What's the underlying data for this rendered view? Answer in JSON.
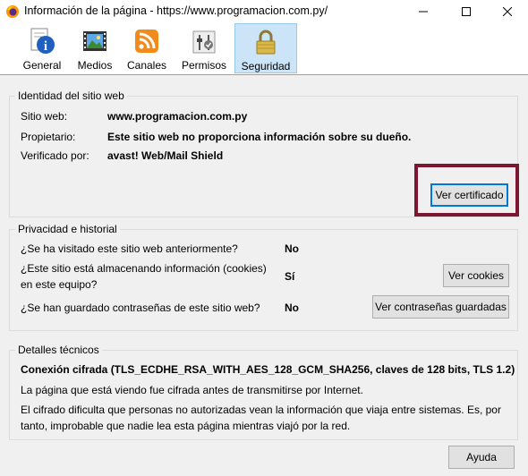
{
  "window": {
    "title": "Información de la página - https://www.programacion.com.py/"
  },
  "tabs": [
    {
      "label": "General",
      "icon": "info-icon"
    },
    {
      "label": "Medios",
      "icon": "media-icon"
    },
    {
      "label": "Canales",
      "icon": "rss-icon"
    },
    {
      "label": "Permisos",
      "icon": "permissions-icon"
    },
    {
      "label": "Seguridad",
      "icon": "lock-icon",
      "selected": true
    }
  ],
  "identity": {
    "legend": "Identidad del sitio web",
    "rows": [
      {
        "label": "Sitio web:",
        "value": "www.programacion.com.py"
      },
      {
        "label": "Propietario:",
        "value": "Este sitio web no proporciona información sobre su dueño."
      },
      {
        "label": "Verificado por:",
        "value": "avast! Web/Mail Shield"
      }
    ],
    "cert_button": "Ver certificado"
  },
  "privacy": {
    "legend": "Privacidad e historial",
    "q1": "¿Se ha visitado este sitio web anteriormente?",
    "a1": "No",
    "q2_line1": "¿Este sitio está almacenando información (cookies)",
    "q2_line2": "en este equipo?",
    "a2": "Sí",
    "cookies_button": "Ver cookies",
    "q3": "¿Se han guardado contraseñas de este sitio web?",
    "a3": "No",
    "passwords_button": "Ver contraseñas guardadas"
  },
  "technical": {
    "legend": "Detalles técnicos",
    "connection": "Conexión cifrada (TLS_ECDHE_RSA_WITH_AES_128_GCM_SHA256, claves de 128 bits, TLS 1.2)",
    "line1": "La página que está viendo fue cifrada antes de transmitirse por Internet.",
    "line2": "El cifrado dificulta que personas no autorizadas vean la información que viaja entre sistemas. Es, por",
    "line3": "tanto, improbable que nadie lea esta página mientras viajó por la red."
  },
  "help_button": "Ayuda",
  "colors": {
    "highlight": "#7b1730",
    "selected_tab": "#cce4f7"
  }
}
